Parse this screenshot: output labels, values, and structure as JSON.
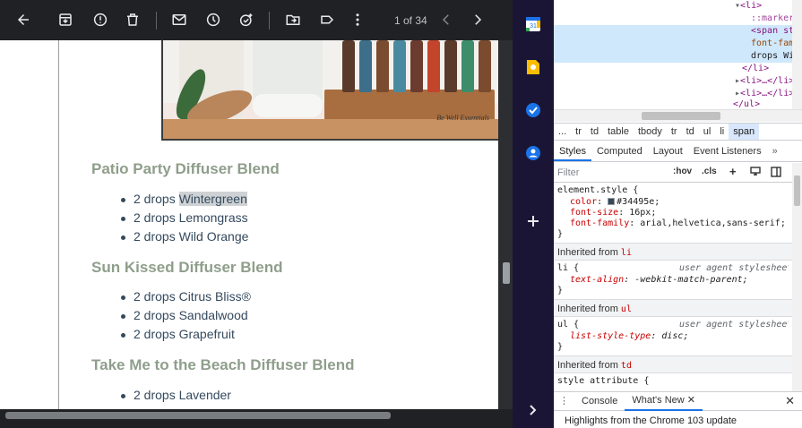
{
  "toolbar": {
    "pager": "1 of 34"
  },
  "photo": {
    "caption": "Be Well Essentials"
  },
  "blends": [
    {
      "title": "Patio Party Diffuser Blend",
      "items": [
        "2 drops ",
        "2 drops Lemongrass",
        "2 drops Wild Orange"
      ],
      "highlight": "Wintergreen"
    },
    {
      "title": "Sun Kissed Diffuser Blend",
      "items": [
        "2 drops Citrus Bliss®",
        "2 drops Sandalwood",
        "2 drops Grapefruit"
      ]
    },
    {
      "title": "Take Me to the Beach Diffuser Blend",
      "items": [
        "2 drops Lavender"
      ]
    }
  ],
  "colors": {
    "heading": "#8f9e8b",
    "list_text": "#34495e",
    "rail_bg": "#1a1535"
  },
  "devtools": {
    "dom": {
      "l1": "<li>",
      "l2": "::marker",
      "l3a": "<span st",
      "l3b": "font-fam",
      "l3c": "drops Wi",
      "l4": "</li>",
      "l5": "<li>…</li>",
      "l6": "<li>…</li>",
      "l7": "</ul>"
    },
    "breadcrumbs": [
      "...",
      "tr",
      "td",
      "table",
      "tbody",
      "tr",
      "td",
      "ul",
      "li",
      "span"
    ],
    "tabs": [
      "Styles",
      "Computed",
      "Layout",
      "Event Listeners"
    ],
    "filter_placeholder": "Filter",
    "hov": ":hov",
    "cls": ".cls",
    "styles": {
      "element_selector": "element.style {",
      "color_prop": "color",
      "color_val": "#34495e;",
      "size_prop": "font-size",
      "size_val": "16px;",
      "family_prop": "font-family",
      "family_val": "arial,helvetica,sans-serif;",
      "close": "}",
      "inherited_li_label": "Inherited from ",
      "inherited_li_tag": "li",
      "li_selector": "li {",
      "ua": "user agent stylesheet",
      "li_prop": "text-align",
      "li_val": "-webkit-match-parent;",
      "inherited_ul_label": "Inherited from ",
      "inherited_ul_tag": "ul",
      "ul_selector": "ul {",
      "ul_prop": "list-style-type",
      "ul_val": "disc;",
      "inherited_td_label": "Inherited from ",
      "inherited_td_tag": "td",
      "style_attr": "style attribute {"
    },
    "drawer": {
      "console": "Console",
      "whats_new": "What's New"
    },
    "highlights": "Highlights from the Chrome 103 update"
  }
}
